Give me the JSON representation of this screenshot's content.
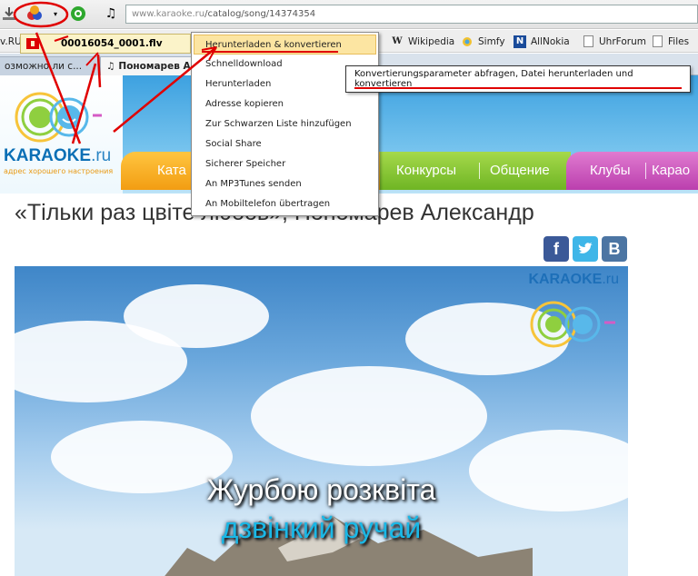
{
  "browser": {
    "address_prefix": "www.karaoke.ru",
    "address_path": "/catalog/song/14374354"
  },
  "bookmarks": {
    "left_partial": "v.RU",
    "items": [
      "Wikipedia",
      "Simfy",
      "AllNokia",
      "UhrForum",
      "Files"
    ]
  },
  "tabs": [
    {
      "label": "озможно ли с..."
    },
    {
      "label": "Пономарев А"
    }
  ],
  "download": {
    "filename": "00016054_0001.flv"
  },
  "context_menu": {
    "items": [
      "Herunterladen & konvertieren",
      "Schnelldownload",
      "Herunterladen",
      "Adresse kopieren",
      "Zur Schwarzen Liste hinzufügen",
      "Social Share",
      "Sicherer Speicher",
      "An MP3Tunes senden",
      "An Mobiltelefon übertragen"
    ],
    "highlighted_index": 0
  },
  "tooltip": {
    "text": "Konvertierungsparameter abfragen, Datei herunterladen und konvertieren"
  },
  "site": {
    "logo_main": "KARAOKE",
    "logo_tld": ".ru",
    "logo_tagline": "адрес хорошего настроения",
    "nav": [
      "Ката",
      "Конкурсы",
      "Общение",
      "Клубы",
      "Карао"
    ]
  },
  "song": {
    "title": "«Тільки раз цвіте любов», Пономарев Александр"
  },
  "share": {
    "facebook": "f",
    "vk": "B"
  },
  "video": {
    "brand_main": "KARAOKE",
    "brand_tld": ".ru",
    "lyric_line_1": "Журбою розквіта",
    "lyric_line_2": "дзвінкий ручай"
  },
  "colors": {
    "annotation_red": "#e00000",
    "menu_highlight": "#fce5a2",
    "nav_orange": "#f29d12",
    "nav_green": "#6fb524",
    "nav_pink": "#bb3fae"
  }
}
